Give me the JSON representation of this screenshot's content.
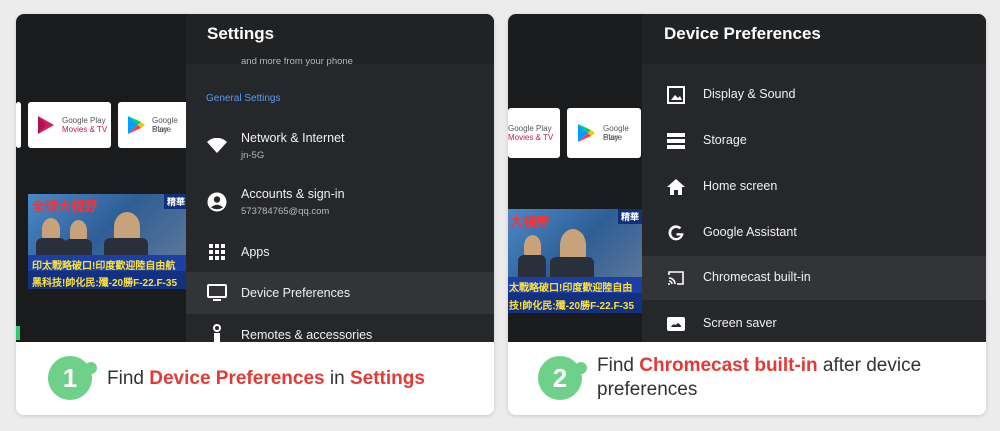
{
  "left": {
    "tiles": [
      {
        "line1": "Google Play",
        "line2": "Movies & TV"
      },
      {
        "line1": "Google Play",
        "line2": "Store"
      }
    ],
    "news": {
      "headline": "全球大視野",
      "tag": "精華",
      "band1": "印太戰略破口!印度歡迎陸自由航",
      "band2": "黑科技!帥化民:殲-20勝F-22.F-35"
    },
    "settings": {
      "title": "Settings",
      "cut_off_text": "and more from your phone",
      "section_label": "General Settings",
      "items": [
        {
          "icon": "wifi-icon",
          "label": "Network & Internet",
          "sub": "jn-5G"
        },
        {
          "icon": "account-icon",
          "label": "Accounts & sign-in",
          "sub": "573784765@qq.com"
        },
        {
          "icon": "apps-grid-icon",
          "label": "Apps"
        },
        {
          "icon": "tv-icon",
          "label": "Device Preferences"
        },
        {
          "icon": "remote-icon",
          "label": "Remotes & accessories"
        }
      ]
    },
    "step": {
      "number": "1",
      "pre": "Find ",
      "highlight1": "Device Preferences",
      "mid": " in ",
      "highlight2": "Settings"
    }
  },
  "right": {
    "tiles": [
      {
        "line1": "Google Play",
        "line2": "Movies & TV"
      },
      {
        "line1": "Google Play",
        "line2": "Store"
      }
    ],
    "news": {
      "headline": "大視野",
      "tag": "精華",
      "band1": "太戰略破口!印度歡迎陸自由",
      "band2": "技!帥化民:殲-20勝F-22.F-35"
    },
    "prefs": {
      "title": "Device Preferences",
      "items": [
        {
          "icon": "image-icon",
          "label": "Display & Sound"
        },
        {
          "icon": "storage-icon",
          "label": "Storage"
        },
        {
          "icon": "home-icon",
          "label": "Home screen"
        },
        {
          "icon": "google-g-icon",
          "label": "Google Assistant"
        },
        {
          "icon": "cast-icon",
          "label": "Chromecast built-in"
        },
        {
          "icon": "screensaver-icon",
          "label": "Screen saver"
        }
      ]
    },
    "step": {
      "number": "2",
      "pre": "Find ",
      "highlight1": "Chromecast built-in",
      "mid": " after device preferences"
    }
  },
  "colors": {
    "step_green": "#6fd08a",
    "highlight_red": "#e53935",
    "section_blue": "#5b9cf2",
    "panel_bg": "#26272a"
  }
}
